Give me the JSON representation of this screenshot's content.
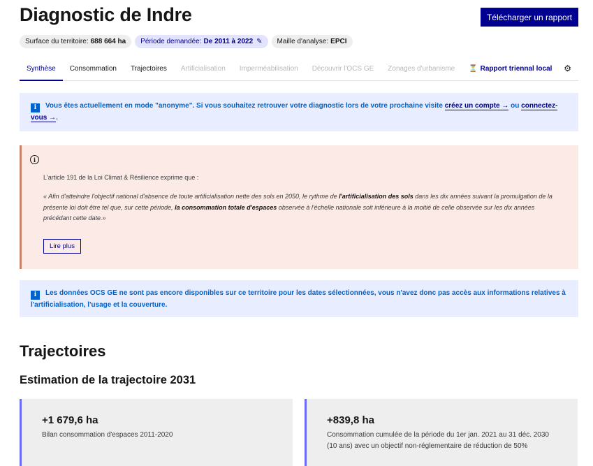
{
  "header": {
    "title": "Diagnostic de Indre",
    "download_label": "Télécharger un rapport"
  },
  "tags": {
    "surface_label": "Surface du territoire:",
    "surface_value": "688 664 ha",
    "period_label": "Période demandée:",
    "period_value": "De 2011 à 2022",
    "mesh_label": "Maille d'analyse:",
    "mesh_value": "EPCI"
  },
  "tabs": {
    "synthese": "Synthèse",
    "consommation": "Consommation",
    "trajectoires": "Trajectoires",
    "artificialisation": "Artificialisation",
    "impermeabilisation": "Imperméabilisation",
    "ocsge": "Découvrir l'OCS GE",
    "zonages": "Zonages d'urbanisme",
    "rapport": "Rapport triennal local",
    "active": "synthese"
  },
  "notice_anonymous": {
    "text": "Vous êtes actuellement en mode \"anonyme\". Si vous souhaitez retrouver votre diagnostic lors de votre prochaine visite",
    "link_create": "créez un compte",
    "or": "ou",
    "link_connect": "connectez-vous",
    "end": "."
  },
  "law_callout": {
    "intro": "L'article 191 de la Loi Climat & Résilience exprime que :",
    "quote_1": "« Afin d'atteindre l'objectif national d'absence de toute artificialisation nette des sols en 2050, le rythme de ",
    "quote_bold_1": "l'artificialisation des sols",
    "quote_2": " dans les dix années suivant la promulgation de la présente loi doit être tel que, sur cette période, ",
    "quote_bold_2": "la consommation totale d'espaces",
    "quote_3": " observée à l'échelle nationale soit inférieure à la moitié de celle observée sur les dix années précédant cette date.»",
    "read_more": "Lire plus"
  },
  "notice_ocsge": {
    "text": "Les données OCS GE ne sont pas encore disponibles sur ce territoire pour les dates sélectionnées, vous n'avez donc pas accès aux informations relatives à l'artificialisation, l'usage et la couverture."
  },
  "section": {
    "title": "Trajectoires",
    "subtitle": "Estimation de la trajectoire 2031"
  },
  "cards": [
    {
      "value": "+1 679,6 ha",
      "description": "Bilan consommation d'espaces 2011-2020"
    },
    {
      "value": "+839,8 ha",
      "description": "Consommation cumulée de la période du 1er jan. 2021 au 31 déc. 2030 (10 ans) avec un objectif non-réglementaire de réduction de 50%"
    }
  ],
  "colors": {
    "primary": "#000091",
    "info": "#0063cb",
    "info_bg": "#e8edff",
    "warning_bg": "#fbeae6",
    "card_accent": "#6a6af4"
  }
}
